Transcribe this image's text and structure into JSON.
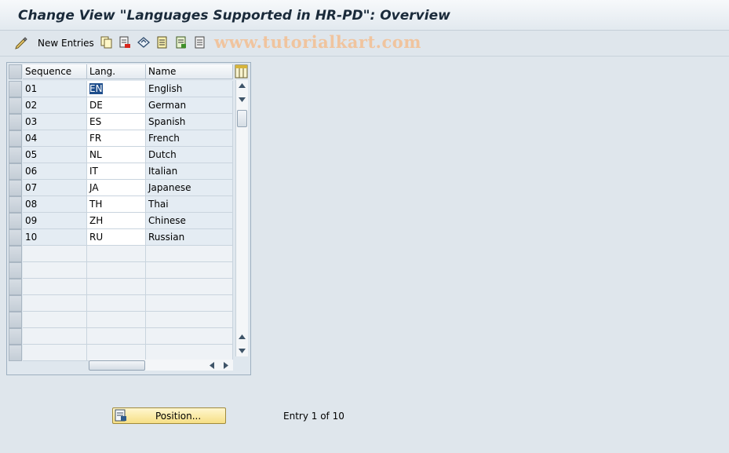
{
  "window": {
    "title": "Change View \"Languages Supported in HR-PD\": Overview"
  },
  "toolbar": {
    "new_entries_label": "New Entries",
    "icons": [
      "edit-pencil-icon",
      "copy-icon",
      "delete-icon",
      "undo-icon",
      "select-all-icon",
      "select-block-icon",
      "deselect-all-icon"
    ],
    "watermark": "www.tutorialkart.com"
  },
  "table": {
    "columns": [
      "Sequence",
      "Lang.",
      "Name"
    ],
    "rows": [
      {
        "seq": "01",
        "lang": "EN",
        "name": "English"
      },
      {
        "seq": "02",
        "lang": "DE",
        "name": "German"
      },
      {
        "seq": "03",
        "lang": "ES",
        "name": "Spanish"
      },
      {
        "seq": "04",
        "lang": "FR",
        "name": "French"
      },
      {
        "seq": "05",
        "lang": "NL",
        "name": "Dutch"
      },
      {
        "seq": "06",
        "lang": "IT",
        "name": "Italian"
      },
      {
        "seq": "07",
        "lang": "JA",
        "name": "Japanese"
      },
      {
        "seq": "08",
        "lang": "TH",
        "name": "Thai"
      },
      {
        "seq": "09",
        "lang": "ZH",
        "name": "Chinese"
      },
      {
        "seq": "10",
        "lang": "RU",
        "name": "Russian"
      }
    ],
    "empty_row_count": 7
  },
  "footer": {
    "position_button_label": "Position...",
    "entry_info": "Entry 1 of 10"
  },
  "colors": {
    "accent": "#f6df85",
    "header_bg": "#e4eaf0",
    "watermark": "#f0c49e"
  }
}
